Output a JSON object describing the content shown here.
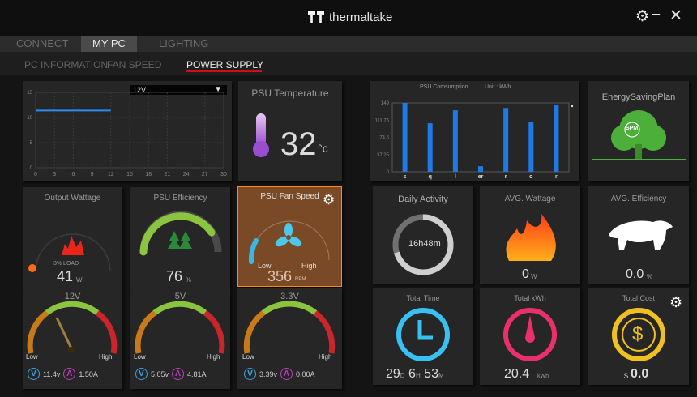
{
  "titlebar": {
    "brand": "thermaltake",
    "settings_icon": "gear-icon",
    "minimize_icon": "minus-icon",
    "close_icon": "close-icon"
  },
  "menu": {
    "items": [
      {
        "label": "CONNECT"
      },
      {
        "label": "MY PC"
      },
      {
        "label": "LIGHTING"
      }
    ],
    "active": "MY PC"
  },
  "submenu": {
    "items": [
      {
        "label": "PC INFORMATION"
      },
      {
        "label": "FAN SPEED"
      },
      {
        "label": "POWER SUPPLY"
      }
    ],
    "active": "POWER SUPPLY"
  },
  "voltage_chart": {
    "selector": "12V"
  },
  "psu_temp": {
    "title": "PSU Temperature",
    "value": "32",
    "unit": "°c"
  },
  "consumption": {
    "title": "PSU Comsumption",
    "unit_label": "Unit : kWh"
  },
  "energy_plan": {
    "title": "EnergySavingPlan",
    "badge": "SPM"
  },
  "output_wattage": {
    "title": "Output Wattage",
    "load": "3% LOAD",
    "value": "41",
    "unit": "W",
    "load_fraction": 0.03
  },
  "psu_efficiency": {
    "title": "PSU Efficiency",
    "value": "76",
    "unit": "%",
    "fraction": 0.76
  },
  "fan_speed": {
    "title": "PSU Fan Speed",
    "low": "Low",
    "high": "High",
    "value": "356",
    "unit": "RPM"
  },
  "daily_activity": {
    "title": "Daily Activity",
    "value": "16h48m"
  },
  "avg_wattage": {
    "title": "AVG. Wattage",
    "value": "0",
    "unit": "W"
  },
  "avg_efficiency": {
    "title": "AVG. Efficiency",
    "value": "0.0",
    "unit": "%"
  },
  "rails": [
    {
      "title": "12V",
      "low": "Low",
      "high": "High",
      "volts": "11.4v",
      "amps": "1.50A",
      "v_letter": "V",
      "a_letter": "A"
    },
    {
      "title": "5V",
      "low": "Low",
      "high": "High",
      "volts": "5.05v",
      "amps": "4.81A",
      "v_letter": "V",
      "a_letter": "A"
    },
    {
      "title": "3.3V",
      "low": "Low",
      "high": "High",
      "volts": "3.39v",
      "amps": "0.00A",
      "v_letter": "V",
      "a_letter": "A"
    }
  ],
  "total_time": {
    "title": "Total Time",
    "d": "29",
    "d_unit": "D",
    "h": "6",
    "h_unit": "H",
    "m": "53",
    "m_unit": "M"
  },
  "total_kwh": {
    "title": "Total kWh",
    "value": "20.4",
    "unit": "kWh"
  },
  "total_cost": {
    "title": "Total Cost",
    "currency": "$",
    "value": "0.0"
  },
  "chart_data": [
    {
      "type": "line",
      "series": [
        {
          "values": [
            11.4,
            11.4,
            11.4,
            11.4,
            11.4,
            11.4,
            11.4,
            11.4,
            11.4,
            11.4,
            11.4,
            11.4,
            11.4
          ]
        }
      ],
      "x": [
        0,
        1,
        2,
        3,
        4,
        5,
        6,
        7,
        8,
        9,
        10,
        11,
        12
      ],
      "x_ticks": [
        "0",
        "3",
        "6",
        "9",
        "12",
        "15",
        "18",
        "21",
        "24",
        "27",
        "30"
      ],
      "y_ticks": [
        "0",
        "5",
        "10",
        "15"
      ],
      "xlim": [
        0,
        30
      ],
      "ylim": [
        0,
        15
      ],
      "grid": true
    },
    {
      "type": "bar",
      "categories": [
        "s",
        "q",
        "l",
        "er",
        "r",
        "o",
        "r"
      ],
      "values": [
        149,
        105,
        133,
        12,
        138,
        107,
        145
      ],
      "y_ticks": [
        "0",
        "37.25",
        "74.5",
        "111.75",
        "149"
      ],
      "ylim": [
        0,
        149
      ],
      "grid": false
    }
  ]
}
